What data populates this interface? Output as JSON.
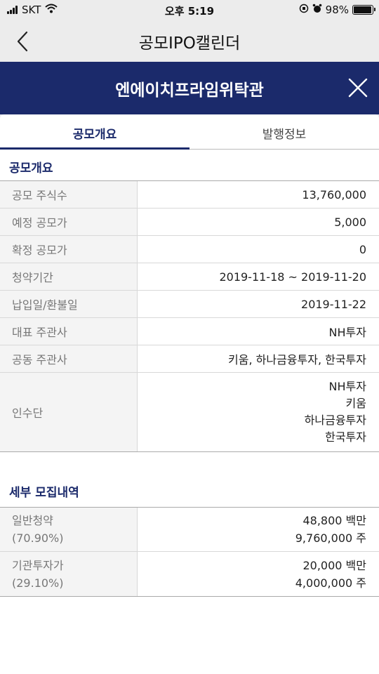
{
  "status_bar": {
    "carrier": "SKT",
    "time": "오후 5:19",
    "battery": "98%",
    "battery_level": 0.98
  },
  "nav": {
    "title": "공모IPO캘린더",
    "back_icon": "chevron-left-icon"
  },
  "modal": {
    "title": "엔에이치프라임위탁관",
    "close_icon": "close-icon"
  },
  "tabs": [
    {
      "label": "공모개요",
      "active": true
    },
    {
      "label": "발행정보",
      "active": false
    }
  ],
  "overview": {
    "section_title": "공모개요",
    "rows": [
      {
        "label": "공모 주식수",
        "value": "13,760,000"
      },
      {
        "label": "예정 공모가",
        "value": "5,000"
      },
      {
        "label": "확정 공모가",
        "value": "0"
      },
      {
        "label": "청약기간",
        "value": "2019-11-18 ~ 2019-11-20"
      },
      {
        "label": "납입일/환불일",
        "value": "2019-11-22"
      },
      {
        "label": "대표 주관사",
        "value": "NH투자"
      },
      {
        "label": "공동 주관사",
        "value": "키움, 하나금융투자, 한국투자"
      }
    ],
    "underwriters": {
      "label": "인수단",
      "values": [
        "NH투자",
        "키움",
        "하나금융투자",
        "한국투자"
      ]
    }
  },
  "details": {
    "section_title": "세부 모집내역",
    "rows": [
      {
        "label": "일반청약",
        "pct": "(70.90%)",
        "amount": "48,800 백만",
        "shares": "9,760,000 주"
      },
      {
        "label": "기관투자가",
        "pct": "(29.10%)",
        "amount": "20,000 백만",
        "shares": "4,000,000 주"
      }
    ]
  },
  "colors": {
    "header_navy": "#1b2a6b",
    "label_bg": "#f4f4f4",
    "nav_bg": "#ececec"
  }
}
